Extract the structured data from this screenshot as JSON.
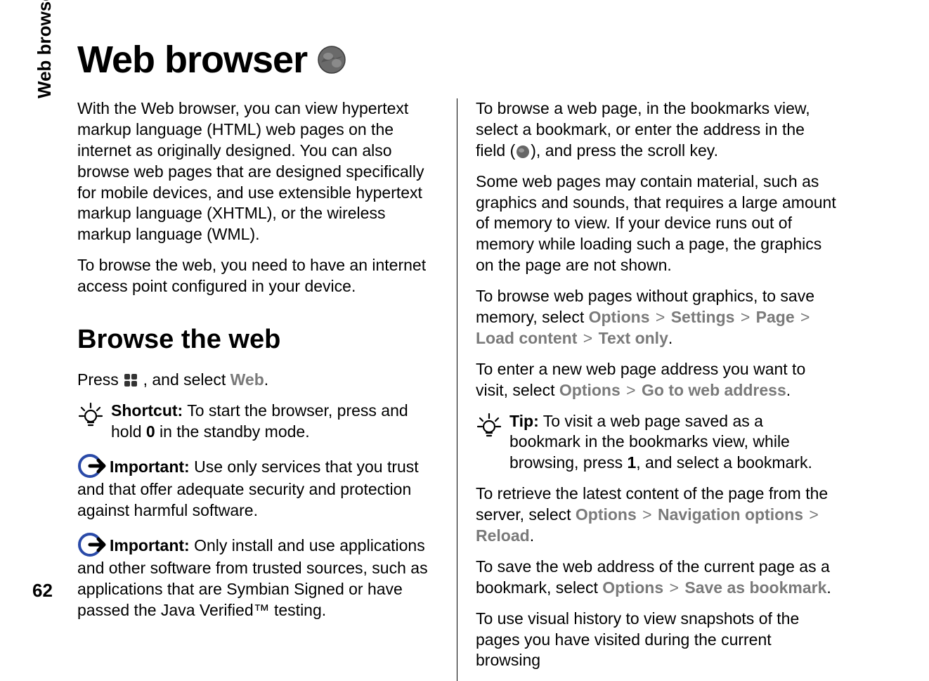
{
  "sideLabel": "Web browser",
  "pageNumber": "62",
  "title": "Web browser",
  "left": {
    "intro1": "With the Web browser, you can view hypertext markup language (HTML) web pages on the internet as originally designed. You can also browse web pages that are designed specifically for mobile devices, and use extensible hypertext markup language (XHTML), or the wireless markup language (WML).",
    "intro2": "To browse the web, you need to have an internet access point configured in your device.",
    "h2": "Browse the web",
    "press_pre": "Press ",
    "press_post": " , and select ",
    "web_label": "Web",
    "period": ".",
    "shortcut_label": "Shortcut:",
    "shortcut_text_pre": " To start the browser, press and hold ",
    "shortcut_key": "0",
    "shortcut_text_post": " in the standby mode.",
    "important_label": "Important:  ",
    "important1": "Use only services that you trust and that offer adequate security and protection against harmful software.",
    "important2": "Only install and use applications and other software from trusted sources, such as applications that are Symbian Signed or have passed the Java Verified™ testing."
  },
  "right": {
    "p1_pre": "To browse a web page, in the bookmarks view, select a bookmark, or enter the address in the field (",
    "p1_post": "), and press the scroll key.",
    "p2": "Some web pages may contain material, such as graphics and sounds, that requires a large amount of memory to view. If your device runs out of memory while loading such a page, the graphics on the page are not shown.",
    "p3_pre": "To browse web pages without graphics, to save memory, select ",
    "p4_pre": "To enter a new web page address you want to visit, select ",
    "tip_label": "Tip:",
    "tip_text_pre": " To visit a web page saved as a bookmark in the bookmarks view, while browsing, press ",
    "tip_key": "1",
    "tip_text_post": ", and select a bookmark.",
    "p5_pre": "To retrieve the latest content of the page from the server, select ",
    "p6_pre": "To save the web address of the current page as a bookmark, select ",
    "p7": "To use visual history to view snapshots of the pages you have visited during the current browsing"
  },
  "menus": {
    "options": "Options",
    "settings": "Settings",
    "page": "Page",
    "load_content": "Load content",
    "text_only": "Text only",
    "goto": "Go to web address",
    "nav_options": "Navigation options",
    "reload": "Reload",
    "save_bookmark": "Save as bookmark"
  }
}
